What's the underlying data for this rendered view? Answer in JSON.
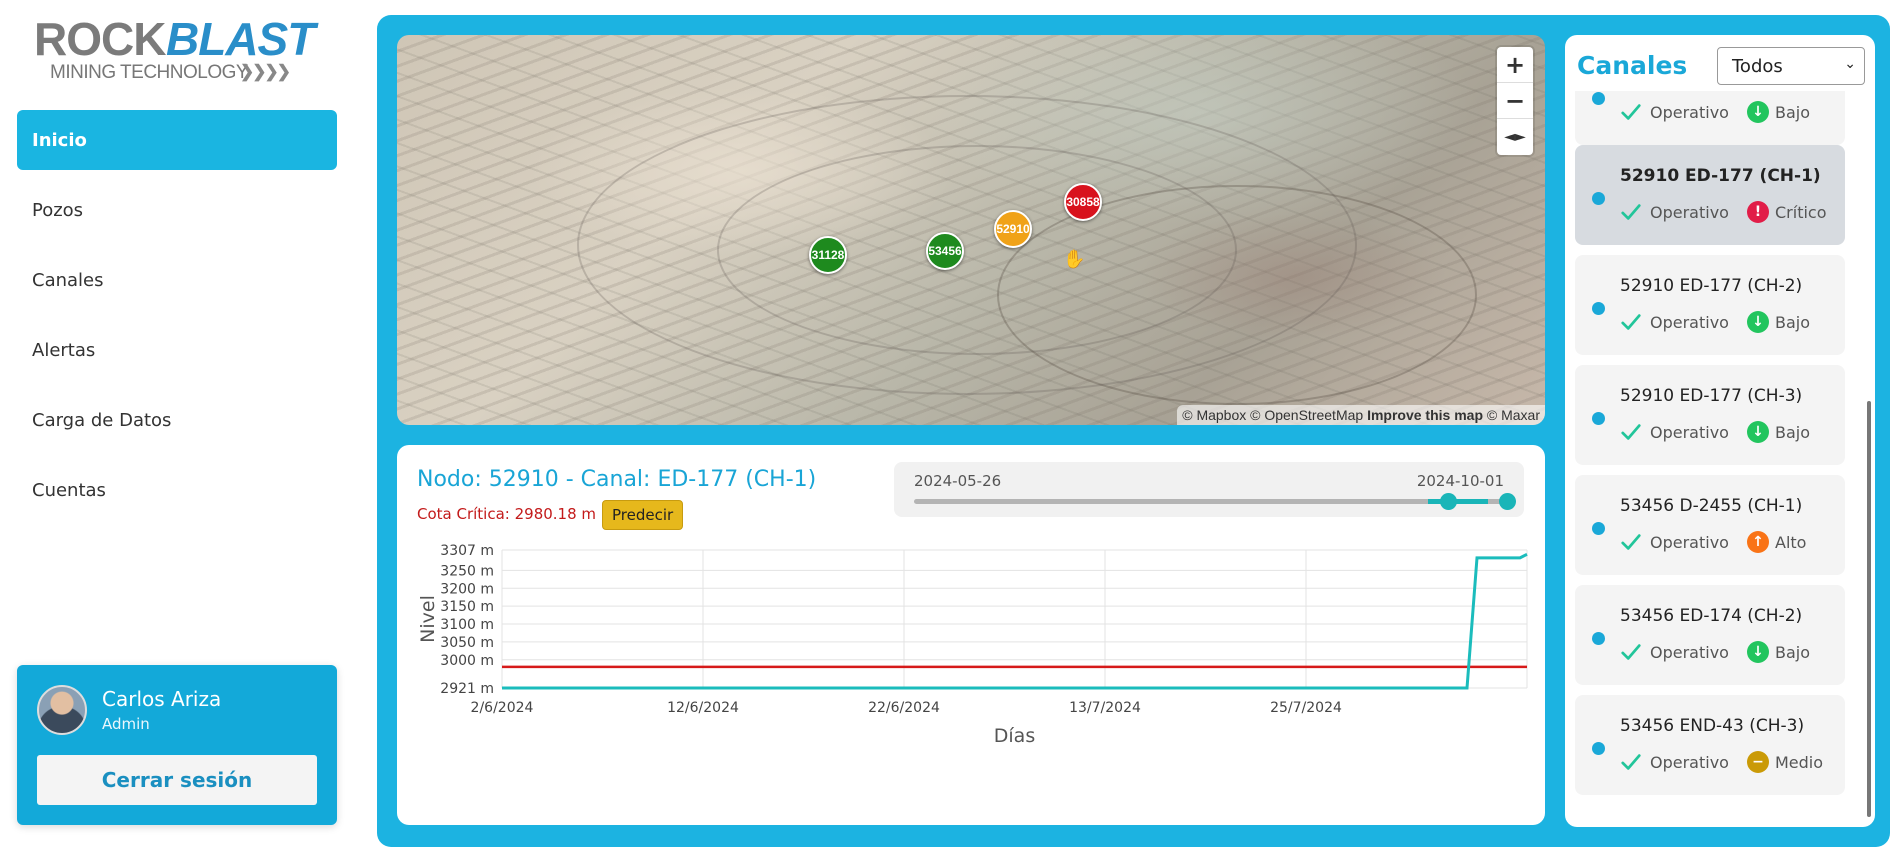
{
  "logo": {
    "rock": "ROCK",
    "blast": "BLAST",
    "subtitle": "MINING TECHNOLOGY",
    "chevrons": "❯❯❯❯"
  },
  "nav": {
    "items": [
      {
        "label": "Inicio",
        "active": true
      },
      {
        "label": "Pozos"
      },
      {
        "label": "Canales"
      },
      {
        "label": "Alertas"
      },
      {
        "label": "Carga de Datos"
      },
      {
        "label": "Cuentas"
      }
    ]
  },
  "user": {
    "name": "Carlos Ariza",
    "role": "Admin",
    "logout_label": "Cerrar sesión"
  },
  "map": {
    "markers": [
      {
        "label": "31128",
        "color": "green"
      },
      {
        "label": "53456",
        "color": "green"
      },
      {
        "label": "52910",
        "color": "orange"
      },
      {
        "label": "30858",
        "color": "red"
      }
    ],
    "zoom_in": "+",
    "zoom_out": "−",
    "compass": "◄►",
    "attribution": "© Mapbox © OpenStreetMap",
    "attribution_bold": "Improve this map",
    "attribution_tail": "© Maxar"
  },
  "chart_panel": {
    "title": "Nodo: 52910 - Canal: ED-177 (CH-1)",
    "cota": "Cota Crítica: 2980.18 m",
    "predict_label": "Predecir",
    "range_start": "2024-05-26",
    "range_end": "2024-10-01"
  },
  "chart_data": {
    "type": "line",
    "xlabel": "Días",
    "ylabel": "Nivel",
    "ylim": [
      2921,
      3307
    ],
    "y_ticks": [
      "3307 m",
      "3250 m",
      "3200 m",
      "3150 m",
      "3100 m",
      "3050 m",
      "3000 m",
      "2921 m"
    ],
    "y_tick_values": [
      3307,
      3250,
      3200,
      3150,
      3100,
      3050,
      3000,
      2921
    ],
    "x_ticks": [
      "2/6/2024",
      "12/6/2024",
      "22/6/2024",
      "13/7/2024",
      "25/7/2024"
    ],
    "critical_level": 2980.18,
    "series": [
      {
        "values": [
          2921,
          2921,
          2921,
          2921,
          2921,
          2921,
          2921,
          3285,
          3285,
          3295
        ]
      }
    ]
  },
  "channels": {
    "title": "Canales",
    "filter_value": "Todos",
    "items": [
      {
        "title": "",
        "status": "Operativo",
        "level": "Bajo",
        "level_color": "#22c55e",
        "level_icon": "↓",
        "selected": false
      },
      {
        "title": "52910 ED-177 (CH-1)",
        "status": "Operativo",
        "level": "Crítico",
        "level_color": "#e11d48",
        "level_icon": "!",
        "selected": true
      },
      {
        "title": "52910 ED-177 (CH-2)",
        "status": "Operativo",
        "level": "Bajo",
        "level_color": "#22c55e",
        "level_icon": "↓",
        "selected": false
      },
      {
        "title": "52910 ED-177 (CH-3)",
        "status": "Operativo",
        "level": "Bajo",
        "level_color": "#22c55e",
        "level_icon": "↓",
        "selected": false
      },
      {
        "title": "53456 D-2455 (CH-1)",
        "status": "Operativo",
        "level": "Alto",
        "level_color": "#f97316",
        "level_icon": "↑",
        "selected": false
      },
      {
        "title": "53456 ED-174 (CH-2)",
        "status": "Operativo",
        "level": "Bajo",
        "level_color": "#22c55e",
        "level_icon": "↓",
        "selected": false
      },
      {
        "title": "53456 END-43 (CH-3)",
        "status": "Operativo",
        "level": "Medio",
        "level_color": "#ca9a06",
        "level_icon": "−",
        "selected": false
      }
    ]
  }
}
